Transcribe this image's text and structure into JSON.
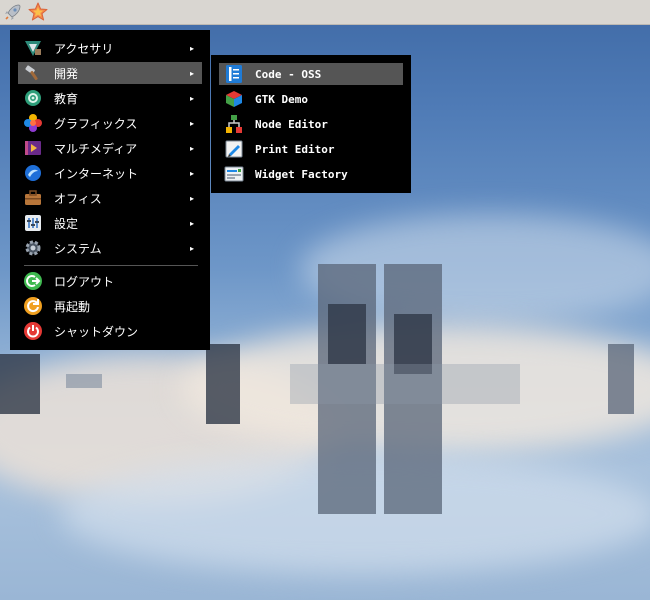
{
  "panel": {
    "buttons": [
      {
        "icon": "rocket-icon"
      },
      {
        "icon": "star-icon"
      }
    ]
  },
  "main_menu": {
    "items": [
      {
        "label": "アクセサリ",
        "icon": "accessories-icon",
        "has_submenu": true
      },
      {
        "label": "開発",
        "icon": "development-icon",
        "has_submenu": true,
        "highlighted": true
      },
      {
        "label": "教育",
        "icon": "education-icon",
        "has_submenu": true
      },
      {
        "label": "グラフィックス",
        "icon": "graphics-icon",
        "has_submenu": true
      },
      {
        "label": "マルチメディア",
        "icon": "multimedia-icon",
        "has_submenu": true
      },
      {
        "label": "インターネット",
        "icon": "internet-icon",
        "has_submenu": true
      },
      {
        "label": "オフィス",
        "icon": "office-icon",
        "has_submenu": true
      },
      {
        "label": "設定",
        "icon": "settings-icon",
        "has_submenu": true
      },
      {
        "label": "システム",
        "icon": "system-icon",
        "has_submenu": true
      }
    ],
    "actions": [
      {
        "label": "ログアウト",
        "icon": "logout-icon",
        "color": "#3fb950"
      },
      {
        "label": "再起動",
        "icon": "restart-icon",
        "color": "#f0a020"
      },
      {
        "label": "シャットダウン",
        "icon": "shutdown-icon",
        "color": "#e53935"
      }
    ],
    "arrow": "▸"
  },
  "sub_menu": {
    "items": [
      {
        "label": "Code - OSS",
        "icon": "code-oss-icon",
        "highlighted": true
      },
      {
        "label": "GTK Demo",
        "icon": "gtk-demo-icon"
      },
      {
        "label": "Node Editor",
        "icon": "node-editor-icon"
      },
      {
        "label": "Print Editor",
        "icon": "print-editor-icon"
      },
      {
        "label": "Widget Factory",
        "icon": "widget-factory-icon"
      }
    ]
  },
  "colors": {
    "menu_bg": "#000000",
    "highlight": "#555555",
    "panel_bg": "#d9d6d1"
  }
}
